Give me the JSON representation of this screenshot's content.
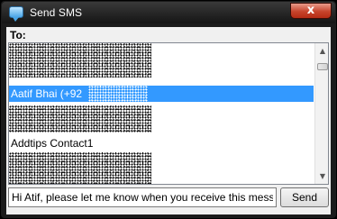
{
  "window": {
    "title": "Send SMS",
    "close_glyph": "x"
  },
  "recipients": {
    "label": "To:",
    "contacts": [
      {
        "name": "Aatif Bhai (+92",
        "selected": true
      },
      {
        "name": "Addtips Contact1",
        "selected": false
      }
    ]
  },
  "message": {
    "value": "Hi Atif, please let me know when you receive this message"
  },
  "send_label": "Send",
  "icons": [
    "sms-icon",
    "close-icon",
    "scroll-up-icon",
    "scroll-down-icon"
  ],
  "colors": {
    "selection": "#3399ff",
    "titlebar": "#1b1b1b",
    "close": "#c7442c"
  }
}
